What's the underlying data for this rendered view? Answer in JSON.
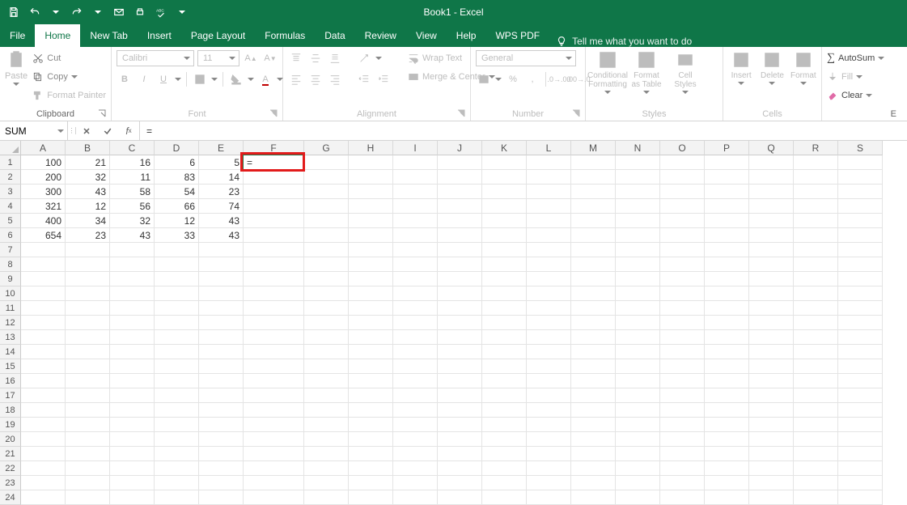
{
  "title": "Book1 - Excel",
  "qat": [
    "save",
    "undo",
    "redo",
    "email",
    "touch",
    "spellcheck"
  ],
  "tabs": [
    "File",
    "Home",
    "New Tab",
    "Insert",
    "Page Layout",
    "Formulas",
    "Data",
    "Review",
    "View",
    "Help",
    "WPS PDF"
  ],
  "tellme": "Tell me what you want to do",
  "ribbon": {
    "clipboard": {
      "paste": "Paste",
      "cut": "Cut",
      "copy": "Copy",
      "fp": "Format Painter",
      "label": "Clipboard"
    },
    "font": {
      "name": "Calibri",
      "size": "11",
      "label": "Font"
    },
    "alignment": {
      "wrap": "Wrap Text",
      "merge": "Merge & Center",
      "label": "Alignment"
    },
    "number": {
      "format": "General",
      "label": "Number"
    },
    "styles": {
      "cond": "Conditional Formatting",
      "table": "Format as Table",
      "cell": "Cell Styles",
      "label": "Styles"
    },
    "cells": {
      "ins": "Insert",
      "del": "Delete",
      "fmt": "Format",
      "label": "Cells"
    },
    "editing": {
      "sum": "AutoSum",
      "fill": "Fill",
      "clear": "Clear",
      "label": "E"
    }
  },
  "namebox": "SUM",
  "formula": "=",
  "columns": [
    "A",
    "B",
    "C",
    "D",
    "E",
    "F",
    "G",
    "H",
    "I",
    "J",
    "K",
    "L",
    "M",
    "N",
    "O",
    "P",
    "Q",
    "R",
    "S"
  ],
  "rows": 24,
  "data": [
    [
      "100",
      "21",
      "16",
      "6",
      "5",
      "="
    ],
    [
      "200",
      "32",
      "11",
      "83",
      "14",
      ""
    ],
    [
      "300",
      "43",
      "58",
      "54",
      "23",
      ""
    ],
    [
      "321",
      "12",
      "56",
      "66",
      "74",
      ""
    ],
    [
      "400",
      "34",
      "32",
      "12",
      "43",
      ""
    ],
    [
      "654",
      "23",
      "43",
      "33",
      "43",
      ""
    ]
  ],
  "activeCell": {
    "row": 0,
    "col": 5
  }
}
